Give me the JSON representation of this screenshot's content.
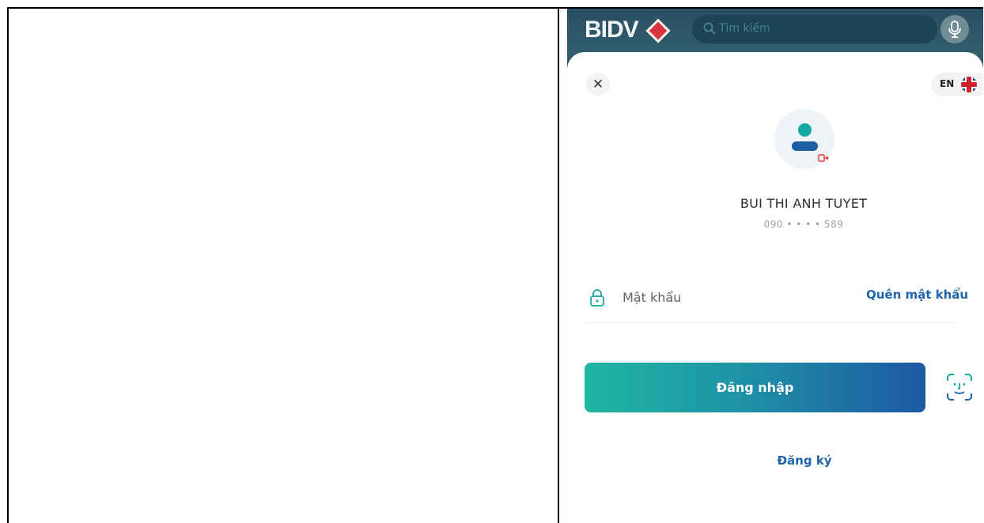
{
  "app": {
    "brand": "BIDV",
    "search_placeholder": "Tìm kiếm"
  },
  "login": {
    "language_code": "EN",
    "user_name": "BUI THI ANH TUYET",
    "user_phone": "090 • • • • 589",
    "password_placeholder": "Mật khẩu",
    "forgot_password_label": "Quên mật khẩu",
    "login_button_label": "Đăng nhập",
    "register_label": "Đăng ký"
  },
  "icons": {
    "close": "close-icon",
    "flag": "uk-flag-icon",
    "avatar": "user-avatar-icon",
    "logout": "logout-icon",
    "lock": "lock-icon",
    "face_id": "face-id-icon",
    "search": "search-icon",
    "mic": "microphone-icon"
  },
  "colors": {
    "header_bg": "#2e5567",
    "brand_red": "#d8343c",
    "primary_blue": "#1e64a8",
    "teal": "#1fb6a3"
  }
}
